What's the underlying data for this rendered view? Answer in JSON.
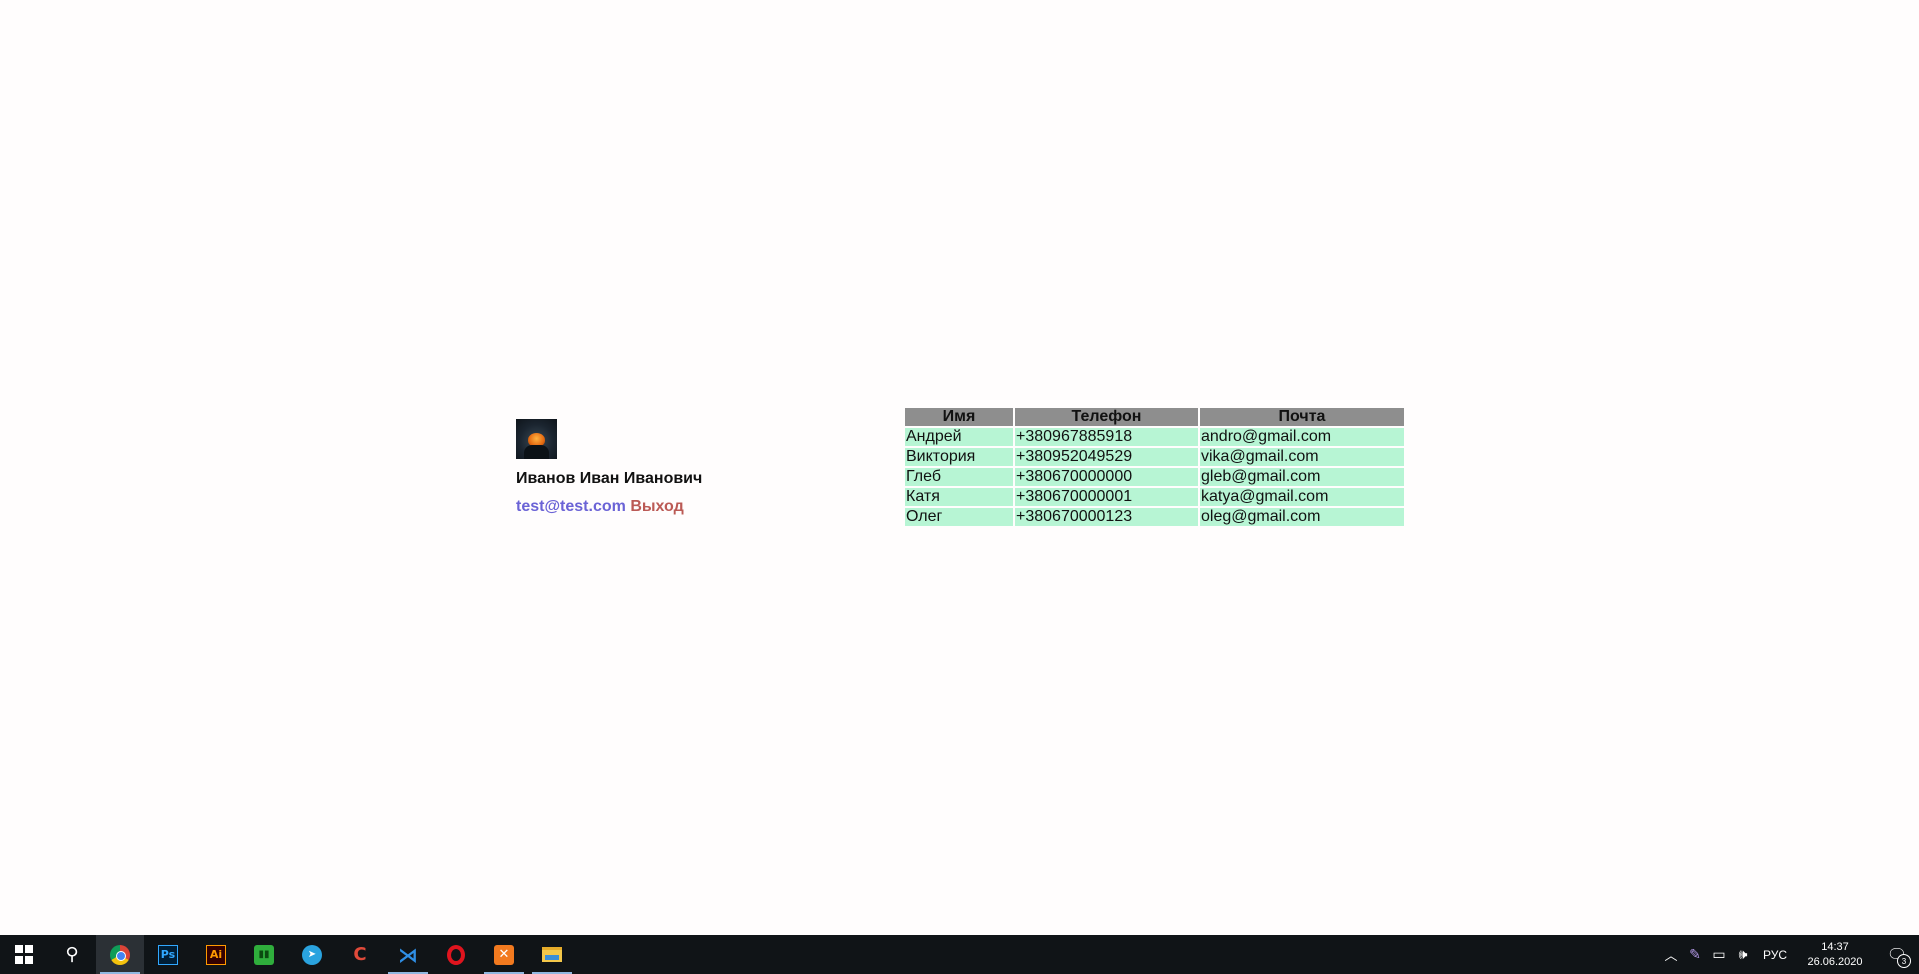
{
  "profile": {
    "name": "Иванов Иван Иванович",
    "email": "test@test.com",
    "logout": "Выход"
  },
  "contacts": {
    "headers": [
      "Имя",
      "Телефон",
      "Почта"
    ],
    "rows": [
      [
        "Андрей",
        "+380967885918",
        "andro@gmail.com"
      ],
      [
        "Виктория",
        "+380952049529",
        "vika@gmail.com"
      ],
      [
        "Глеб",
        "+380670000000",
        "gleb@gmail.com"
      ],
      [
        "Катя",
        "+380670000001",
        "katya@gmail.com"
      ],
      [
        "Олег",
        "+380670000123",
        "oleg@gmail.com"
      ]
    ]
  },
  "taskbar": {
    "apps": [
      "start-icon",
      "search-icon",
      "chrome-icon",
      "photoshop-icon",
      "illustrator-icon",
      "green-app-icon",
      "telegram-icon",
      "ccleaner-icon",
      "vscode-icon",
      "opera-icon",
      "xampp-icon",
      "file-explorer-icon"
    ],
    "ps_label": "Ps",
    "ai_label": "Ai",
    "language": "РУС",
    "time": "14:37",
    "date": "26.06.2020",
    "notifications_count": "3"
  },
  "colors": {
    "header_bg": "#8e8e8e",
    "row_bg": "#b7f5d4",
    "email_link": "#6b63d6",
    "logout_link": "#bb5a55",
    "taskbar_bg": "#101417"
  }
}
